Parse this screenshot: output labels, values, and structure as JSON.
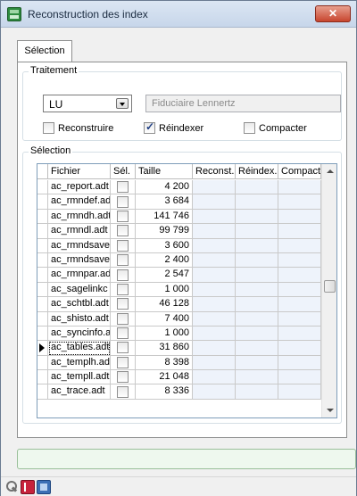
{
  "window": {
    "title": "Reconstruction des index",
    "close_glyph": "✕"
  },
  "tabs": [
    {
      "label": "Sélection",
      "active": true
    }
  ],
  "traitement": {
    "legend": "Traitement",
    "combo_value": "LU",
    "company_field": "Fiduciaire Lennertz",
    "checkboxes": [
      {
        "label": "Reconstruire",
        "checked": false
      },
      {
        "label": "Réindexer",
        "checked": true
      },
      {
        "label": "Compacter",
        "checked": false
      }
    ]
  },
  "selection": {
    "legend": "Sélection",
    "columns": [
      "Fichier",
      "Sél.",
      "Taille",
      "Reconst.",
      "Réindex.",
      "Compact."
    ],
    "rows": [
      {
        "file": "ac_report.adt",
        "sel": false,
        "size": "4 200"
      },
      {
        "file": "ac_rmndef.adt",
        "sel": false,
        "size": "3 684"
      },
      {
        "file": "ac_rmndh.adt",
        "sel": false,
        "size": "141 746"
      },
      {
        "file": "ac_rmndl.adt",
        "sel": false,
        "size": "99 799"
      },
      {
        "file": "ac_rmndsave",
        "sel": false,
        "size": "3 600"
      },
      {
        "file": "ac_rmndsave",
        "sel": false,
        "size": "2 400"
      },
      {
        "file": "ac_rmnpar.adt",
        "sel": false,
        "size": "2 547"
      },
      {
        "file": "ac_sagelinkc",
        "sel": false,
        "size": "1 000"
      },
      {
        "file": "ac_schtbl.adt",
        "sel": false,
        "size": "46 128"
      },
      {
        "file": "ac_shisto.adt",
        "sel": false,
        "size": "7 400"
      },
      {
        "file": "ac_syncinfo.adt",
        "sel": false,
        "size": "1 000"
      },
      {
        "file": "ac_tables.adt",
        "sel": false,
        "size": "31 860",
        "current": true
      },
      {
        "file": "ac_templh.adt",
        "sel": false,
        "size": "8 398"
      },
      {
        "file": "ac_templl.adt",
        "sel": false,
        "size": "21 048"
      },
      {
        "file": "ac_trace.adt",
        "sel": false,
        "size": "8 336"
      }
    ]
  },
  "icons": {
    "app": "app-icon",
    "bottom": [
      "tools-icon",
      "book-icon",
      "screen-icon"
    ]
  },
  "colors": {
    "title_bg": "#c7d6ea",
    "close": "#c7452e",
    "status_bg": "#eef8ee"
  }
}
